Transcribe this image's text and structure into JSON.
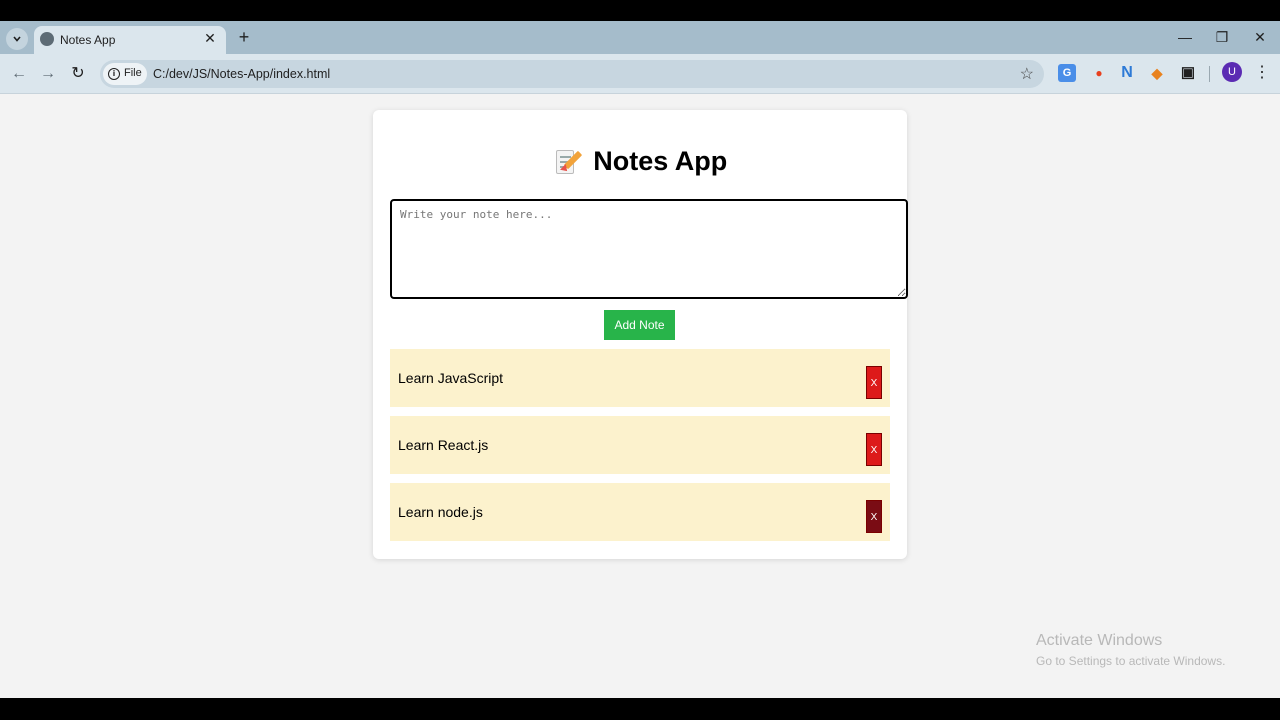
{
  "browser": {
    "tab_title": "Notes App",
    "tab_close": "✕",
    "new_tab": "+",
    "url_chip": "File",
    "url": "C:/dev/JS/Notes-App/index.html",
    "avatar_letter": "U",
    "window_controls": {
      "minimize": "—",
      "restore": "❐",
      "close": "✕"
    }
  },
  "app": {
    "title": "Notes App",
    "input_placeholder": "Write your note here...",
    "add_button": "Add Note",
    "delete_label": "X",
    "notes": [
      {
        "text": "Learn JavaScript"
      },
      {
        "text": "Learn React.js"
      },
      {
        "text": "Learn node.js"
      }
    ]
  },
  "watermark": {
    "line1": "Activate Windows",
    "line2": "Go to Settings to activate Windows."
  },
  "colors": {
    "add_button": "#28b44a",
    "delete_button": "#dd1a1a",
    "note_background": "#fcf2cd"
  }
}
